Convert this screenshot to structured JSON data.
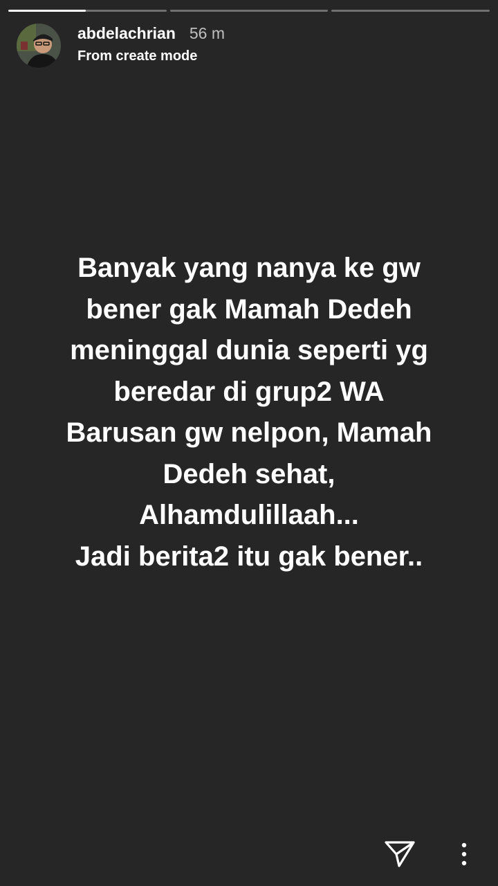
{
  "story": {
    "progress": [
      {
        "segment": 1,
        "filled": 0.49
      },
      {
        "segment": 2,
        "filled": 0.0
      },
      {
        "segment": 3,
        "filled": 0.0
      }
    ],
    "username": "abdelachrian",
    "time_ago": "56 m",
    "subtitle": "From create mode",
    "background_color": "#262626",
    "caption_lines": [
      "Banyak yang nanya ke gw",
      "bener gak Mamah Dedeh",
      "meninggal dunia seperti yg",
      "beredar di grup2 WA",
      "Barusan gw nelpon, Mamah",
      "Dedeh sehat,",
      "Alhamdulillaah...",
      "Jadi berita2 itu gak bener.."
    ]
  },
  "actions": {
    "send_icon": "paper-plane-icon",
    "more_icon": "vertical-dots-icon"
  }
}
